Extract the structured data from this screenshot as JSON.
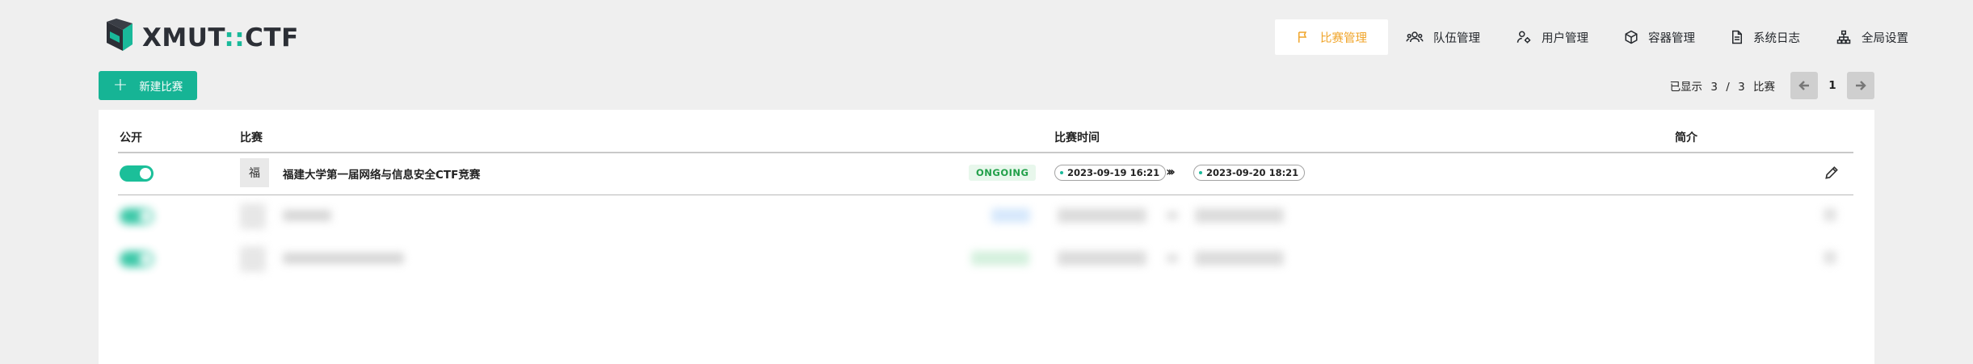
{
  "app": {
    "logo_main": "XMUT",
    "logo_sep": "::",
    "logo_suffix": "CTF"
  },
  "nav": {
    "items": [
      {
        "label": "比赛管理",
        "icon": "flag-icon",
        "active": true
      },
      {
        "label": "队伍管理",
        "icon": "team-icon",
        "active": false
      },
      {
        "label": "用户管理",
        "icon": "user-settings-icon",
        "active": false
      },
      {
        "label": "容器管理",
        "icon": "box-icon",
        "active": false
      },
      {
        "label": "系统日志",
        "icon": "file-log-icon",
        "active": false
      },
      {
        "label": "全局设置",
        "icon": "hierarchy-icon",
        "active": false
      }
    ]
  },
  "toolbar": {
    "new_button": "新建比赛"
  },
  "pager": {
    "prefix": "已显示",
    "shown": "3",
    "slash": "/",
    "total": "3",
    "suffix": "比赛",
    "page": "1"
  },
  "table": {
    "headers": {
      "public": "公开",
      "game": "比赛",
      "time": "比赛时间",
      "intro": "简介"
    },
    "rows": [
      {
        "public": true,
        "avatar": "福",
        "title": "福建大学第一届网络与信息安全CTF竞赛",
        "status": "ONGOING",
        "start": "2023-09-19 16:21",
        "end": "2023-09-20 18:21"
      }
    ]
  },
  "colors": {
    "accent": "#16b495",
    "active_nav": "#f0a52b",
    "status_ongoing": "#22a04a"
  }
}
